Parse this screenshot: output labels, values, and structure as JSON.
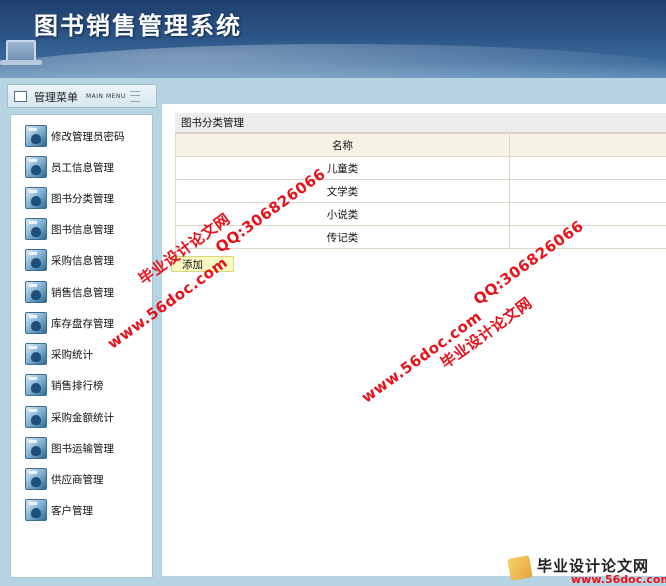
{
  "app": {
    "title": "图书销售管理系统"
  },
  "menu": {
    "title": "管理菜单",
    "subtitle": "MAIN MENU",
    "items": [
      {
        "label": "修改管理员密码"
      },
      {
        "label": "员工信息管理"
      },
      {
        "label": "图书分类管理"
      },
      {
        "label": "图书信息管理"
      },
      {
        "label": "采购信息管理"
      },
      {
        "label": "销售信息管理"
      },
      {
        "label": "库存盘存管理"
      },
      {
        "label": "采购统计"
      },
      {
        "label": "销售排行榜"
      },
      {
        "label": "采购金额统计"
      },
      {
        "label": "图书运输管理"
      },
      {
        "label": "供应商管理"
      },
      {
        "label": "客户管理"
      }
    ]
  },
  "panel": {
    "title": "图书分类管理",
    "columns": [
      "名称",
      ""
    ],
    "rows": [
      {
        "name": "儿童类"
      },
      {
        "name": "文学类"
      },
      {
        "name": "小说类"
      },
      {
        "name": "传记类"
      }
    ],
    "add_label": "添加"
  },
  "watermarks": {
    "site_cn": "毕业设计论文网",
    "site_url": "www.56doc.com",
    "qq": "QQ:306826066"
  },
  "logo": {
    "name": "毕业设计论文网",
    "url": "www.56doc.com"
  },
  "colors": {
    "header": "#2c5486",
    "sidebar": "#b6d4e2",
    "add_button": "#fafbc4",
    "watermark": "#e8111b"
  }
}
